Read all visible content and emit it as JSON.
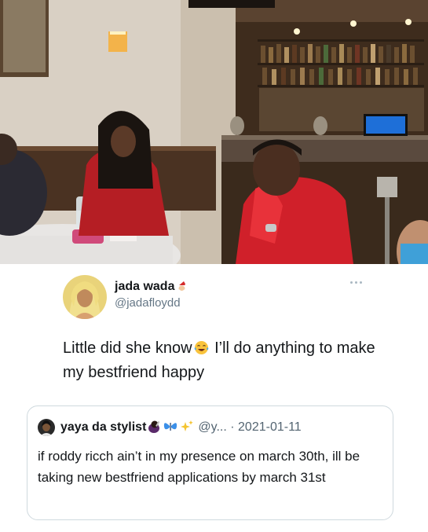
{
  "photo": {
    "description_icon": "restaurant-photo"
  },
  "tweet": {
    "author_name": "jada wada",
    "author_handle": "@jadafloydd",
    "name_emoji_icon": "santa-emoji-icon",
    "more_icon": "ellipsis-icon",
    "text_part1": "Little did she know",
    "laugh_icon": "tears-of-joy-emoji-icon",
    "text_part2": " I’ll do anything to make my bestfriend happy"
  },
  "quoted": {
    "author_name": "yaya da stylist",
    "emoji_icons": [
      "hairdresser-emoji-icon",
      "butterfly-emoji-icon",
      "sparkles-emoji-icon"
    ],
    "author_handle": "@y...",
    "separator": "·",
    "date": "2021-01-11",
    "text": "if roddy ricch ain’t in my presence on march 30th, ill be taking new bestfriend applications by march 31st"
  },
  "colors": {
    "primary_text": "#14171a",
    "secondary_text": "#657786",
    "border": "#cfd9de",
    "jacket_red": "#d0202a"
  }
}
